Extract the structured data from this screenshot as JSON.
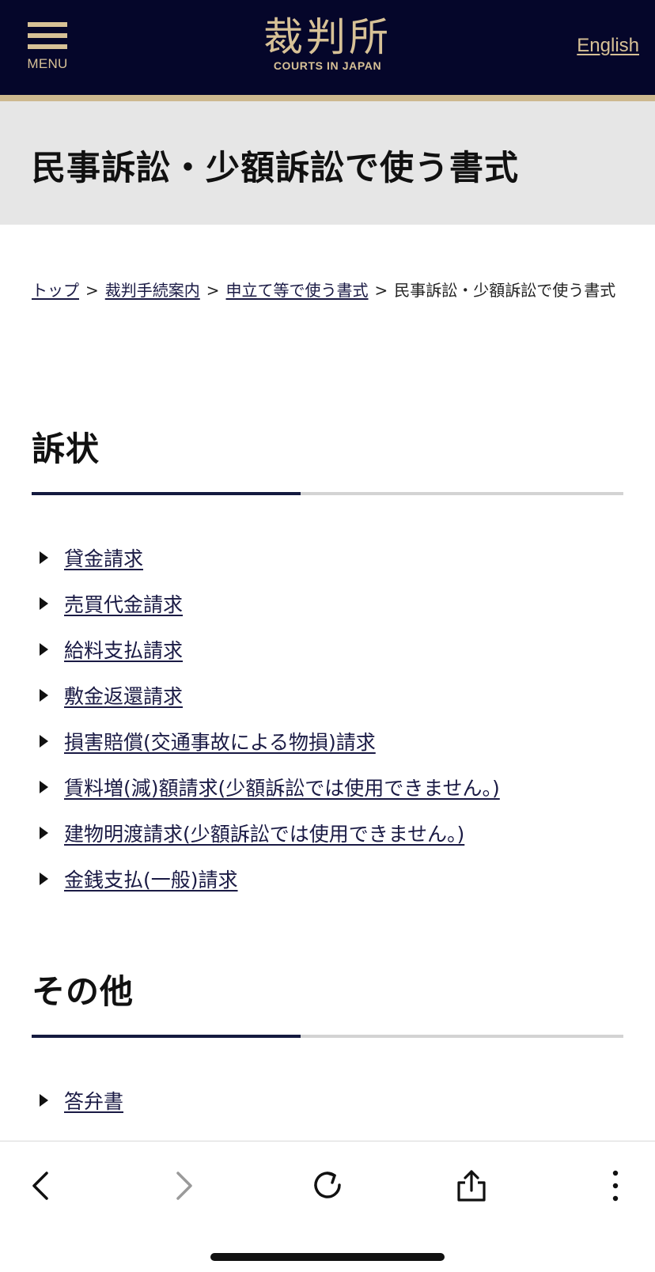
{
  "header": {
    "menu_label": "MENU",
    "logo_kanji": "裁判所",
    "logo_sub": "COURTS IN JAPAN",
    "language_link": "English"
  },
  "page_title": "民事訴訟・少額訴訟で使う書式",
  "breadcrumb": {
    "items": [
      "トップ",
      "裁判手続案内",
      "申立て等で使う書式"
    ],
    "current": "民事訴訟・少額訴訟で使う書式",
    "separator": ">"
  },
  "sections": [
    {
      "heading": "訴状",
      "links": [
        "貸金請求",
        "売買代金請求",
        "給料支払請求",
        "敷金返還請求",
        "損害賠償(交通事故による物損)請求",
        "賃料増(減)額請求(少額訴訟では使用できません。)",
        "建物明渡請求(少額訴訟では使用できません。)",
        "金銭支払(一般)請求"
      ]
    },
    {
      "heading": "その他",
      "links": [
        "答弁書"
      ]
    }
  ],
  "browser_toolbar": {
    "icons": [
      "back-icon",
      "forward-icon",
      "reload-icon",
      "share-icon",
      "more-icon"
    ]
  },
  "colors": {
    "header_bg": "#05062a",
    "gold": "#d7c196",
    "stripe": "#cdb88f",
    "title_band": "#e6e6e6",
    "accent_rule": "#141a3f",
    "link": "#1a1a44"
  }
}
